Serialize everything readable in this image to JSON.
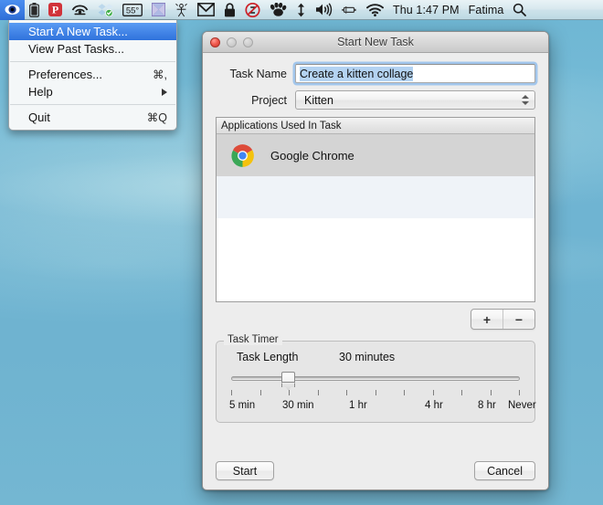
{
  "menubar": {
    "status_icons": [
      {
        "name": "eye-icon",
        "glyph": "eye",
        "active": true
      },
      {
        "name": "battery-icon",
        "glyph": "battery"
      },
      {
        "name": "pocket-icon",
        "glyph": "P"
      },
      {
        "name": "airfoil-icon",
        "glyph": "airfoil"
      },
      {
        "name": "dropbox-icon",
        "glyph": "dropbox"
      },
      {
        "name": "temperature-icon",
        "glyph": "55°"
      },
      {
        "name": "crashplan-icon",
        "glyph": "x-square"
      },
      {
        "name": "scrivener-icon",
        "glyph": "stick-figure"
      },
      {
        "name": "gmail-icon",
        "glyph": "M"
      },
      {
        "name": "lock-icon",
        "glyph": "lock"
      },
      {
        "name": "do-not-disturb-icon",
        "glyph": "no-sleep"
      },
      {
        "name": "bear-paw-icon",
        "glyph": "paw"
      },
      {
        "name": "display-arrows-icon",
        "glyph": "updown"
      },
      {
        "name": "volume-icon",
        "glyph": "speaker"
      },
      {
        "name": "bluetooth-icon",
        "glyph": "bt"
      },
      {
        "name": "wifi-icon",
        "glyph": "wifi"
      }
    ],
    "temperature": "55°",
    "clock": "Thu 1:47 PM",
    "user": "Fatima",
    "search_icon": "spotlight-search-icon",
    "highlight_color": "#3a7de0"
  },
  "app_menu": {
    "items": [
      {
        "label": "Start A New Task...",
        "shortcut": "",
        "selected": true,
        "submenu": false
      },
      {
        "label": "View Past Tasks...",
        "shortcut": "",
        "selected": false,
        "submenu": false
      },
      {
        "separator": true
      },
      {
        "label": "Preferences...",
        "shortcut": "⌘,",
        "selected": false,
        "submenu": false
      },
      {
        "label": "Help",
        "shortcut": "",
        "selected": false,
        "submenu": true
      },
      {
        "separator": true
      },
      {
        "label": "Quit",
        "shortcut": "⌘Q",
        "selected": false,
        "submenu": false
      }
    ]
  },
  "window": {
    "title": "Start New Task",
    "controls": {
      "close": "close-button",
      "minimize": "minimize-button",
      "zoom": "zoom-button"
    },
    "form": {
      "task_name_label": "Task Name",
      "task_name_value": "Create a kitten collage",
      "project_label": "Project",
      "project_value": "Kitten"
    },
    "apps_list": {
      "header": "Applications Used In Task",
      "rows": [
        {
          "name": "Google Chrome",
          "icon": "google-chrome-icon"
        }
      ],
      "add_label": "+",
      "remove_label": "−"
    },
    "timer": {
      "legend": "Task Timer",
      "length_label": "Task Length",
      "length_value": "30 minutes",
      "slider_position_pct": 19,
      "tick_count": 11,
      "scale_labels": [
        "5 min",
        "30 min",
        "1 hr",
        "4 hr",
        "8 hr",
        "Never"
      ]
    },
    "buttons": {
      "start": "Start",
      "cancel": "Cancel"
    }
  }
}
